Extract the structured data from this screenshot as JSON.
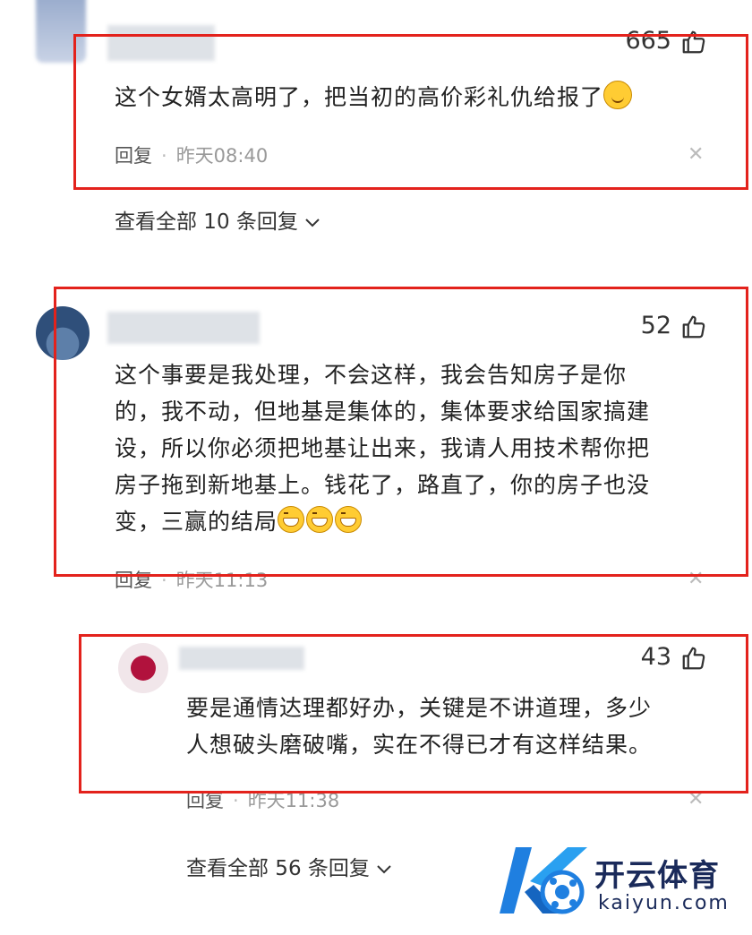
{
  "comments": [
    {
      "likes": "665",
      "text": "这个女婿太高明了，把当初的高价彩礼仇给报了",
      "reply_label": "回复",
      "time": "昨天08:40",
      "view_all": "查看全部 10 条回复"
    },
    {
      "likes": "52",
      "text_lines": [
        "这个事要是我处理，不会这样，我会告知房子是你",
        "的，我不动，但地基是集体的，集体要求给国家搞建",
        "设，所以你必须把地基让出来，我请人用技术帮你把",
        "房子拖到新地基上。钱花了，路直了，你的房子也没",
        "变，三赢的结局"
      ],
      "reply_label": "回复",
      "time": "昨天11:13",
      "nested": {
        "likes": "43",
        "text_lines": [
          "要是通情达理都好办，关键是不讲道理，多少",
          "人想破头磨破嘴，实在不得已才有这样结果。"
        ],
        "reply_label": "回复",
        "time": "昨天11:38"
      },
      "view_all": "查看全部 56 条回复"
    }
  ],
  "watermark": {
    "brand": "开云体育",
    "url": "kaiyun.com"
  },
  "colors": {
    "highlight_box": "#e3221c",
    "brand_blue": "#1f7fe0",
    "brand_dark": "#1a2a5a"
  },
  "icons": {
    "like": "thumbs-up-icon",
    "close": "close-icon",
    "expand": "chevron-down-icon"
  }
}
